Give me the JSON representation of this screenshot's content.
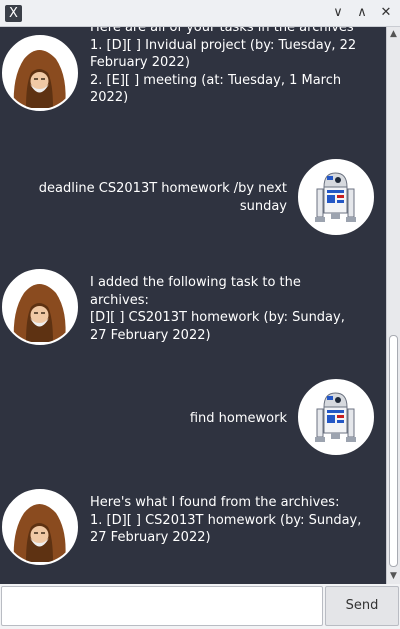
{
  "window": {
    "app_icon_glyph": "X",
    "controls": {
      "minimize": "∨",
      "maximize": "∧",
      "close": "✕"
    }
  },
  "messages": [
    {
      "sender": "duke",
      "lines": [
        "Here are all of your tasks in the archives",
        "1. [D][ ] Invidual project (by: Tuesday, 22",
        "February 2022)",
        "2. [E][ ] meeting (at: Tuesday, 1 March",
        "2022)"
      ]
    },
    {
      "sender": "user",
      "lines": [
        "deadline CS2013T homework /by next",
        "sunday"
      ]
    },
    {
      "sender": "duke",
      "lines": [
        "I added the following task to the",
        "archives:",
        "[D][ ] CS2013T homework (by: Sunday,",
        "27 February 2022)"
      ]
    },
    {
      "sender": "user",
      "lines": [
        "find homework"
      ]
    },
    {
      "sender": "duke",
      "lines": [
        "Here's what I found from the archives:",
        "1. [D][ ] CS2013T homework (by: Sunday,",
        "27 February 2022)"
      ]
    }
  ],
  "input": {
    "value": "",
    "placeholder": ""
  },
  "send_label": "Send",
  "colors": {
    "chat_bg": "#2f3340",
    "text": "#ffffff",
    "avatar_border": "#ffffff"
  }
}
